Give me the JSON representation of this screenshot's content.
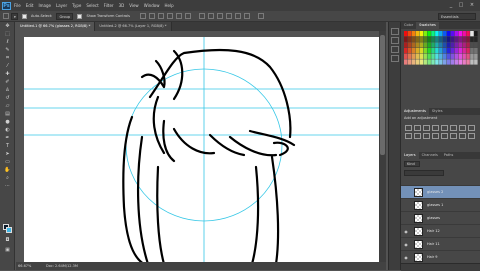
{
  "app": {
    "logo": "Ps"
  },
  "menu": [
    "File",
    "Edit",
    "Image",
    "Layer",
    "Type",
    "Select",
    "Filter",
    "3D",
    "View",
    "Window",
    "Help"
  ],
  "window_controls": [
    "_",
    "□",
    "×"
  ],
  "options_bar": {
    "tool_preset": "▾",
    "mode_label": "Auto-Select:",
    "mode_value": "Group",
    "show_transform_label": "Show Transform Controls",
    "workspace": "Essentials"
  },
  "document_tabs": [
    "Untitled-1 @ 66.7% (glasses 2, RGB/8) *",
    "Untitled-2 @ 66.7% (Layer 1, RGB/8) *"
  ],
  "status": {
    "zoom": "66.67%",
    "doc": "Doc: 2.64M/12.3M"
  },
  "panels": {
    "color_tabs": [
      "Color",
      "Swatches"
    ],
    "adjust_tabs": [
      "Adjustments",
      "Styles"
    ],
    "adjust_title": "Add an adjustment",
    "layer_tabs": [
      "Layers",
      "Channels",
      "Paths"
    ],
    "layer_kind": "Kind"
  },
  "layers": [
    {
      "name": "glasses 2",
      "visible": false,
      "selected": true
    },
    {
      "name": "glasses 1",
      "visible": false,
      "selected": false
    },
    {
      "name": "glasses",
      "visible": false,
      "selected": false
    },
    {
      "name": "Hair 12",
      "visible": true,
      "selected": false
    },
    {
      "name": "Hair 11",
      "visible": true,
      "selected": false
    },
    {
      "name": "Hair 9",
      "visible": true,
      "selected": false
    }
  ],
  "colors": {
    "foreground": "#0a1a2a",
    "background": "#3fb6e6",
    "guide": "#35c7e6",
    "selection": "#7391b8"
  },
  "icons": {
    "eye": "eye-icon",
    "tools": [
      "move-tool-icon",
      "marquee-tool-icon",
      "lasso-tool-icon",
      "quick-select-icon",
      "crop-tool-icon",
      "eyedropper-icon",
      "heal-brush-icon",
      "brush-tool-icon",
      "clone-stamp-icon",
      "history-brush-icon",
      "eraser-icon",
      "gradient-icon",
      "blur-icon",
      "dodge-icon",
      "pen-tool-icon",
      "type-tool-icon",
      "path-select-icon",
      "shape-tool-icon",
      "hand-tool-icon",
      "zoom-tool-icon"
    ]
  }
}
